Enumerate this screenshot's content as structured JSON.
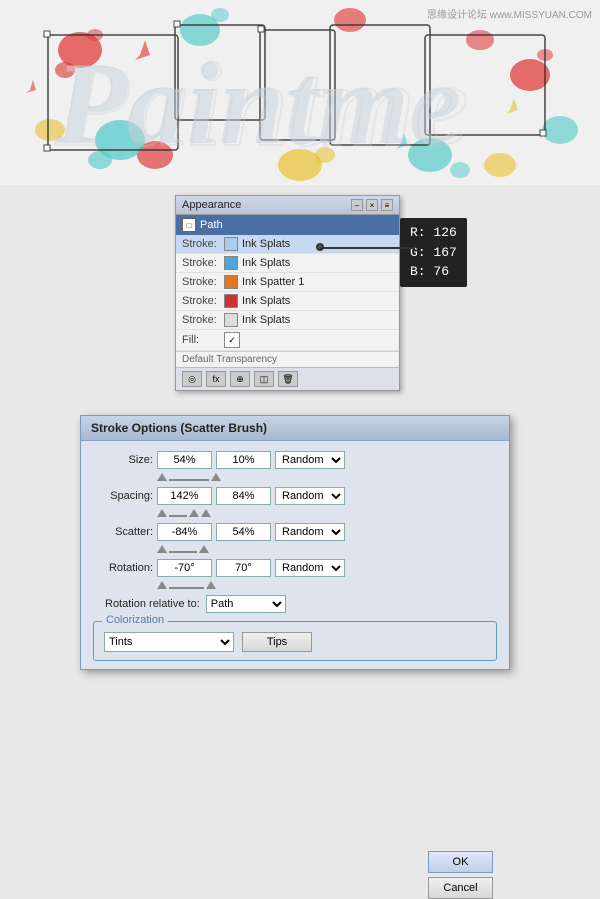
{
  "watermark": "思缘设计论坛 www.MISSYUAN.COM",
  "appearance_panel": {
    "title": "Appearance",
    "close_btn": "×",
    "minimize_btn": "–",
    "menu_btn": "≡",
    "path_label": "Path",
    "rows": [
      {
        "label": "Stroke:",
        "color": "#aaccee",
        "text": "Ink Splats",
        "swatch_color": "#aaccee"
      },
      {
        "label": "Stroke:",
        "color": "#4da6d6",
        "text": "Ink Splats",
        "swatch_color": "#4da6d6"
      },
      {
        "label": "Stroke:",
        "color": "#e07820",
        "text": "Ink Spatter 1",
        "swatch_color": "#e07820"
      },
      {
        "label": "Stroke:",
        "color": "#cc3333",
        "text": "Ink Splats",
        "swatch_color": "#cc3333"
      },
      {
        "label": "Stroke:",
        "color": "#dddddd",
        "text": "Ink Splats",
        "swatch_color": "#dddddd"
      },
      {
        "label": "Fill:",
        "text": ""
      }
    ],
    "footer": "Default Transparency"
  },
  "color_tooltip": {
    "r_label": "R:",
    "r_value": "126",
    "g_label": "G:",
    "g_value": "167",
    "b_label": "B:",
    "b_value": " 76"
  },
  "stroke_dialog": {
    "title": "Stroke Options (Scatter Brush)",
    "size_label": "Size:",
    "size_val1": "54%",
    "size_val2": "10%",
    "size_dropdown": "Random",
    "spacing_label": "Spacing:",
    "spacing_val1": "142%",
    "spacing_val2": "84%",
    "spacing_dropdown": "Random",
    "scatter_label": "Scatter:",
    "scatter_val1": "-84%",
    "scatter_val2": "54%",
    "scatter_dropdown": "Random",
    "rotation_label": "Rotation:",
    "rotation_val1": "-70°",
    "rotation_val2": "70°",
    "rotation_dropdown": "Random",
    "relative_label": "Rotation relative to:",
    "relative_val": "Path",
    "colorization_label": "Colorization",
    "color_method": "Tints",
    "tips_btn": "Tips",
    "ok_btn": "OK",
    "cancel_btn": "Cancel"
  }
}
